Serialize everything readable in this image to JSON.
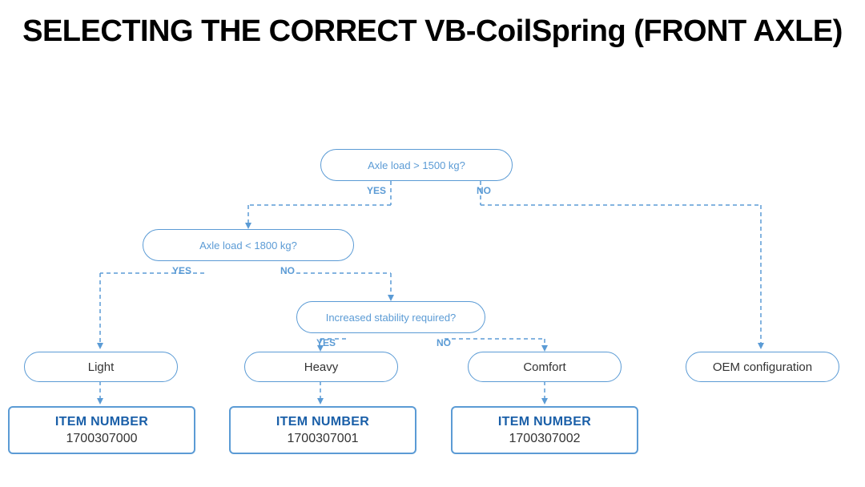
{
  "title": "SELECTING THE CORRECT VB-CoilSpring (FRONT AXLE)",
  "decision1": {
    "text": "Axle load > 1500 kg?",
    "yes": "YES",
    "no": "NO"
  },
  "decision2": {
    "text": "Axle load < 1800 kg?",
    "yes": "YES",
    "no": "NO"
  },
  "decision3": {
    "text": "Increased stability required?",
    "yes": "YES",
    "no": "NO"
  },
  "results": {
    "light": "Light",
    "heavy": "Heavy",
    "comfort": "Comfort",
    "oem": "OEM configuration"
  },
  "items": {
    "item0": {
      "label": "ITEM NUMBER",
      "number": "1700307000"
    },
    "item1": {
      "label": "ITEM NUMBER",
      "number": "1700307001"
    },
    "item2": {
      "label": "ITEM NUMBER",
      "number": "1700307002"
    }
  }
}
